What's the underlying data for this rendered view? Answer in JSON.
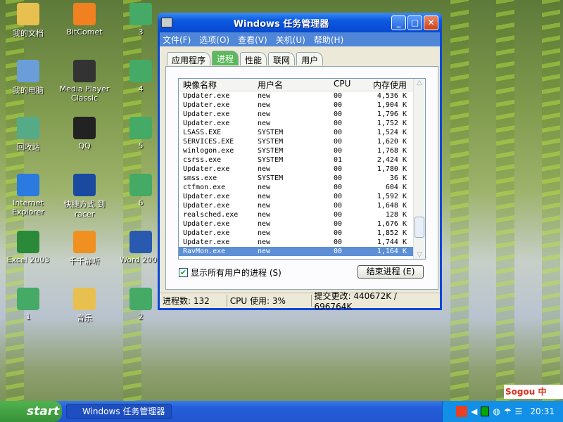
{
  "desktop_icons": [
    {
      "label": "我的文档",
      "icon": "folder-documents-icon",
      "color": "#e8c050"
    },
    {
      "label": "BitComet",
      "icon": "bitcomet-icon",
      "color": "#f08020"
    },
    {
      "label": "3",
      "icon": "media-file-icon",
      "color": "#4a6"
    },
    {
      "label": "我的电脑",
      "icon": "computer-icon",
      "color": "#6a9ed8"
    },
    {
      "label": "Media Player Classic",
      "icon": "media-player-icon",
      "color": "#333"
    },
    {
      "label": "4",
      "icon": "media-file-icon",
      "color": "#4a6"
    },
    {
      "label": "回收站",
      "icon": "recycle-bin-icon",
      "color": "#5a8"
    },
    {
      "label": "QQ",
      "icon": "qq-penguin-icon",
      "color": "#222"
    },
    {
      "label": "5",
      "icon": "media-file-icon",
      "color": "#4a6"
    },
    {
      "label": "Internet Explorer",
      "icon": "internet-explorer-icon",
      "color": "#2a7ae0"
    },
    {
      "label": "快捷方式 到 racer",
      "icon": "racer-icon",
      "color": "#1a4aa0"
    },
    {
      "label": "6",
      "icon": "media-file-icon",
      "color": "#4a6"
    },
    {
      "label": "Excel 2003",
      "icon": "excel-icon",
      "color": "#2a8a3a"
    },
    {
      "label": "千千静听",
      "icon": "ttplayer-icon",
      "color": "#f09020"
    },
    {
      "label": "Word 2003",
      "icon": "word-icon",
      "color": "#2a5ab0"
    },
    {
      "label": "1",
      "icon": "media-file-icon",
      "color": "#4a6"
    },
    {
      "label": "音乐",
      "icon": "folder-music-icon",
      "color": "#e8c050"
    },
    {
      "label": "2",
      "icon": "media-file-icon",
      "color": "#4a6"
    }
  ],
  "window": {
    "title": "Windows 任务管理器",
    "menu": [
      "文件(F)",
      "选项(O)",
      "查看(V)",
      "关机(U)",
      "帮助(H)"
    ],
    "tabs": [
      {
        "label": "应用程序",
        "active": false
      },
      {
        "label": "进程",
        "active": true
      },
      {
        "label": "性能",
        "active": false
      },
      {
        "label": "联网",
        "active": false
      },
      {
        "label": "用户",
        "active": false
      }
    ],
    "columns": [
      "映像名称",
      "用户名",
      "CPU",
      "内存使用"
    ],
    "rows": [
      [
        "Updater.exe",
        "new",
        "00",
        "4,536 K"
      ],
      [
        "Updater.exe",
        "new",
        "00",
        "1,904 K"
      ],
      [
        "Updater.exe",
        "new",
        "00",
        "1,796 K"
      ],
      [
        "Updater.exe",
        "new",
        "00",
        "1,752 K"
      ],
      [
        "LSASS.EXE",
        "SYSTEM",
        "00",
        "1,524 K"
      ],
      [
        "SERVICES.EXE",
        "SYSTEM",
        "00",
        "1,620 K"
      ],
      [
        "winlogon.exe",
        "SYSTEM",
        "00",
        "1,768 K"
      ],
      [
        "csrss.exe",
        "SYSTEM",
        "01",
        "2,424 K"
      ],
      [
        "Updater.exe",
        "new",
        "00",
        "1,780 K"
      ],
      [
        "smss.exe",
        "SYSTEM",
        "00",
        "36 K"
      ],
      [
        "ctfmon.exe",
        "new",
        "00",
        "604 K"
      ],
      [
        "Updater.exe",
        "new",
        "00",
        "1,592 K"
      ],
      [
        "Updater.exe",
        "new",
        "00",
        "1,648 K"
      ],
      [
        "realsched.exe",
        "new",
        "00",
        "128 K"
      ],
      [
        "Updater.exe",
        "new",
        "00",
        "1,676 K"
      ],
      [
        "Updater.exe",
        "new",
        "00",
        "1,852 K"
      ],
      [
        "Updater.exe",
        "new",
        "00",
        "1,744 K"
      ],
      [
        "RavMon.exe",
        "new",
        "00",
        "1,164 K"
      ]
    ],
    "selected_row": 17,
    "show_all_label": "显示所有用户的进程 (S)",
    "show_all_checked": true,
    "end_process_label": "结束进程 (E)",
    "status": {
      "processes": "进程数: 132",
      "cpu": "CPU 使用: 3%",
      "commit": "提交更改: 440672K / 696764K"
    }
  },
  "taskbar": {
    "start": "start",
    "task": "Windows 任务管理器",
    "clock": "20:31",
    "ime": "Sogou 中"
  }
}
